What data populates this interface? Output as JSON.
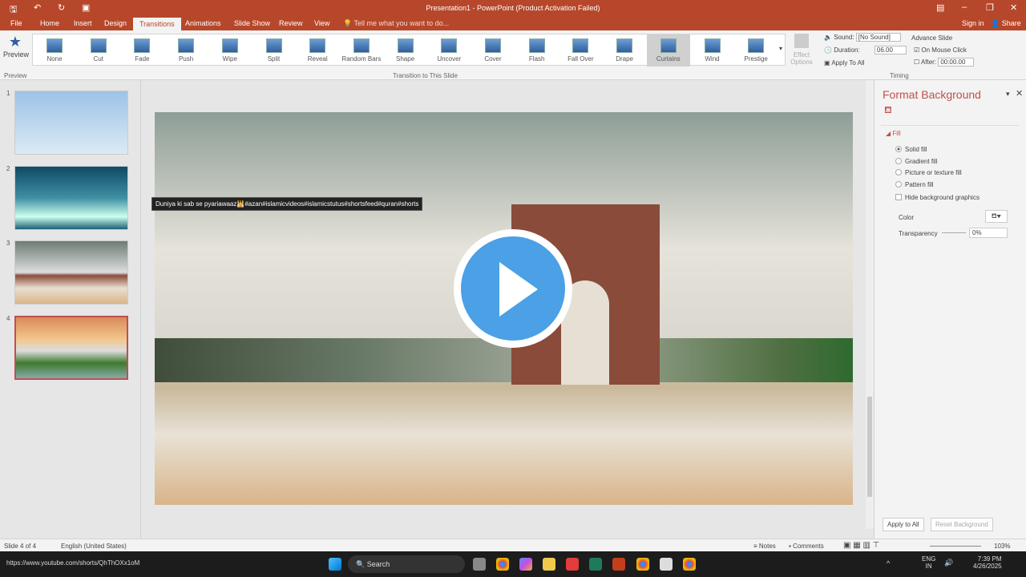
{
  "window": {
    "title": "Presentation1 - PowerPoint (Product Activation Failed)",
    "sign_in": "Sign in",
    "share": "Share"
  },
  "tabs": [
    "File",
    "Home",
    "Insert",
    "Design",
    "Transitions",
    "Animations",
    "Slide Show",
    "Review",
    "View"
  ],
  "active_tab": "Transitions",
  "tell_me": "Tell me what you want to do...",
  "ribbon": {
    "preview": "Preview",
    "transitions": [
      "None",
      "Cut",
      "Fade",
      "Push",
      "Wipe",
      "Split",
      "Reveal",
      "Random Bars",
      "Shape",
      "Uncover",
      "Cover",
      "Flash",
      "Fall Over",
      "Drape",
      "Curtains",
      "Wind",
      "Prestige"
    ],
    "selected": "Curtains",
    "effect_options": "Effect Options",
    "groups": {
      "preview": "Preview",
      "transition": "Transition to This Slide",
      "timing": "Timing"
    },
    "timing": {
      "sound_label": "Sound:",
      "sound_value": "[No Sound]",
      "duration_label": "Duration:",
      "duration_value": "06.00",
      "apply_all": "Apply To All",
      "advance": "Advance Slide",
      "on_click": "On Mouse Click",
      "on_click_checked": true,
      "after": "After:",
      "after_value": "00:00.00",
      "after_checked": false
    }
  },
  "slides": {
    "numbers": [
      "1",
      "2",
      "3",
      "4"
    ],
    "current": 4
  },
  "tooltip": "Duniya ki sab se pyariawaaz🕌#azan#islamicvideos#islamicstutus#shortsfeed#quran#shorts",
  "panel": {
    "title": "Format Background",
    "section": "Fill",
    "options": [
      "Solid fill",
      "Gradient fill",
      "Picture or texture fill",
      "Pattern fill"
    ],
    "selected": "Solid fill",
    "hide_bg": "Hide background graphics",
    "color_label": "Color",
    "transparency_label": "Transparency",
    "transparency_value": "0%",
    "apply_all": "Apply to All",
    "reset": "Reset Background"
  },
  "status": {
    "slide": "Slide 4 of 4",
    "language": "English (United States)",
    "notes": "Notes",
    "comments": "Comments",
    "zoom": "103%"
  },
  "taskbar": {
    "url": "https://www.youtube.com/shorts/QhThOXx1oM",
    "search": "Search",
    "lang1": "ENG",
    "lang2": "IN",
    "time": "7:39 PM",
    "date": "4/26/2025"
  },
  "colors": {
    "accent": "#b7472a",
    "play": "#4ba0e6"
  }
}
